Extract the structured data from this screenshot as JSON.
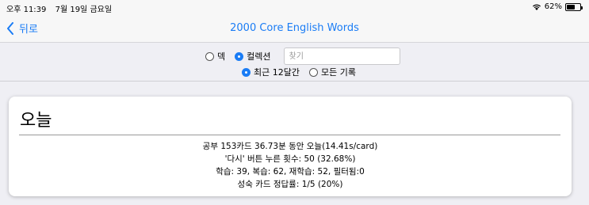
{
  "status": {
    "time": "오후 11:39",
    "date": "7월 19일 금요일",
    "battery": "62%",
    "battery_level": 0.62
  },
  "nav": {
    "back_label": "뒤로",
    "title": "2000 Core English Words"
  },
  "filters": {
    "deck_label": "덱",
    "collection_label": "컬렉션",
    "search_placeholder": "찾기",
    "recent_label": "최근 12달간",
    "all_label": "모든 기록"
  },
  "today": {
    "title": "오늘",
    "lines": [
      "공부 153카드 36.73분 동안 오늘(14.41s/card)",
      "'다시' 버튼 누른 횟수: 50 (32.68%)",
      "학습: 39, 복습: 62, 재학습: 52, 필터됨:0",
      "성숙 카드 정답률: 1/5 (20%)"
    ]
  },
  "colors": {
    "accent": "#1a7cf5"
  }
}
